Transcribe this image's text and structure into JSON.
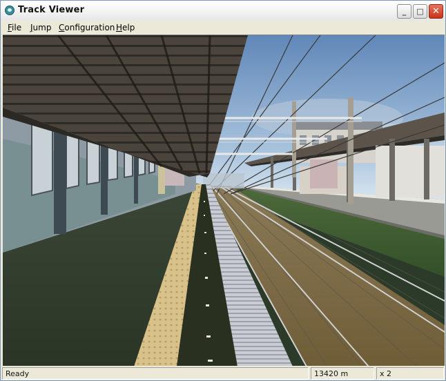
{
  "window": {
    "title": "Track Viewer",
    "icon": "track-viewer-app-icon",
    "minimize_glyph": "_",
    "maximize_glyph": "□",
    "close_glyph": "✕",
    "close_color": "#d9452a"
  },
  "menu": {
    "items": [
      {
        "label": "File"
      },
      {
        "label": "Jump"
      },
      {
        "label": "Configuration"
      },
      {
        "label": "Help"
      }
    ]
  },
  "statusbar": {
    "status": "Ready",
    "distance": "13420 m",
    "speed": "x 2"
  },
  "viewport": {
    "scene": "3d-railway-station-platform",
    "sky_color": "#8fb3d6",
    "ballast_color": "#7a6a42",
    "tactile_strip_color": "#d8c084"
  }
}
